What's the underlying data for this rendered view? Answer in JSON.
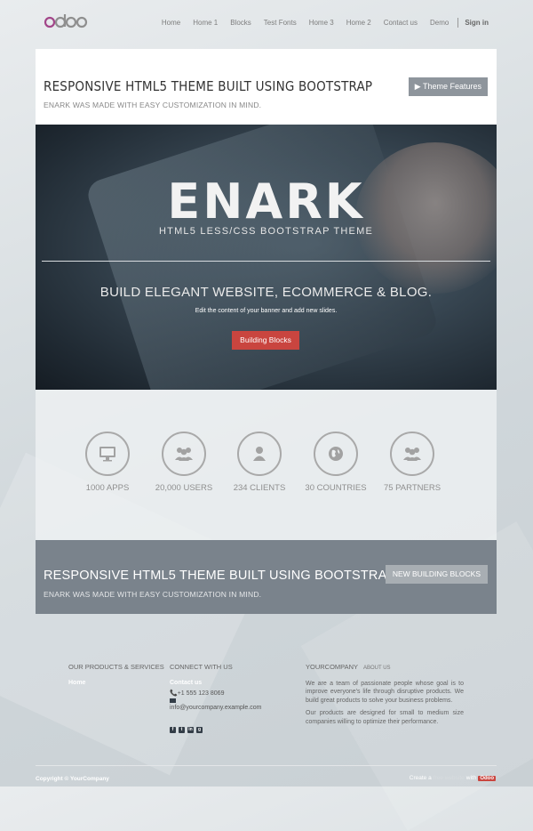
{
  "nav": {
    "logo": "odoo",
    "links": [
      "Home",
      "Home 1",
      "Blocks",
      "Test Fonts",
      "Home 3",
      "Home 2",
      "Contact us",
      "Demo"
    ],
    "signin": "Sign in"
  },
  "top": {
    "title": "RESPONSIVE HTML5 THEME BUILT USING BOOTSTRAP",
    "subtitle": "ENARK WAS MADE WITH EASY CUSTOMIZATION IN MIND.",
    "button": "Theme Features"
  },
  "banner": {
    "title": "ENARK",
    "subtitle": "HTML5 LESS/CSS BOOTSTRAP THEME",
    "tagline": "BUILD ELEGANT WEBSITE, ECOMMERCE & BLOG.",
    "description": "Edit the content of your banner and add new slides.",
    "button": "Building Blocks"
  },
  "stats": [
    {
      "label": "1000 APPS",
      "icon": "monitor-icon"
    },
    {
      "label": "20,000 USERS",
      "icon": "users-icon"
    },
    {
      "label": "234 CLIENTS",
      "icon": "user-icon"
    },
    {
      "label": "30 COUNTRIES",
      "icon": "globe-icon"
    },
    {
      "label": "75 PARTNERS",
      "icon": "users-icon"
    }
  ],
  "grey": {
    "title": "RESPONSIVE HTML5 THEME BUILT USING BOOTSTRAP",
    "subtitle": "ENARK WAS MADE WITH EASY CUSTOMIZATION IN MIND.",
    "button": "NEW BUILDING BLOCKS"
  },
  "footer": {
    "products_heading": "OUR PRODUCTS & SERVICES",
    "products_link": "Home",
    "connect_heading": "CONNECT WITH US",
    "contact_link": "Contact us",
    "phone": "+1 555 123 8069",
    "email": "info@yourcompany.example.com",
    "company_heading": "YOURCOMPANY",
    "about_link": "ABOUT US",
    "about_p1": "We are a team of passionate people whose goal is to improve everyone's life through disruptive products. We build great products to solve your business problems.",
    "about_p2": "Our products are designed for small to medium size companies willing to optimize their performance.",
    "copyright": "Copyright © YourCompany",
    "create_text": "Create a",
    "free_website": "free website",
    "with_text": "with",
    "odoo_badge": "Odoo"
  },
  "colors": {
    "accent_red": "#c9453f",
    "grey_band": "#7a838c",
    "logo_purple": "#a24689"
  }
}
